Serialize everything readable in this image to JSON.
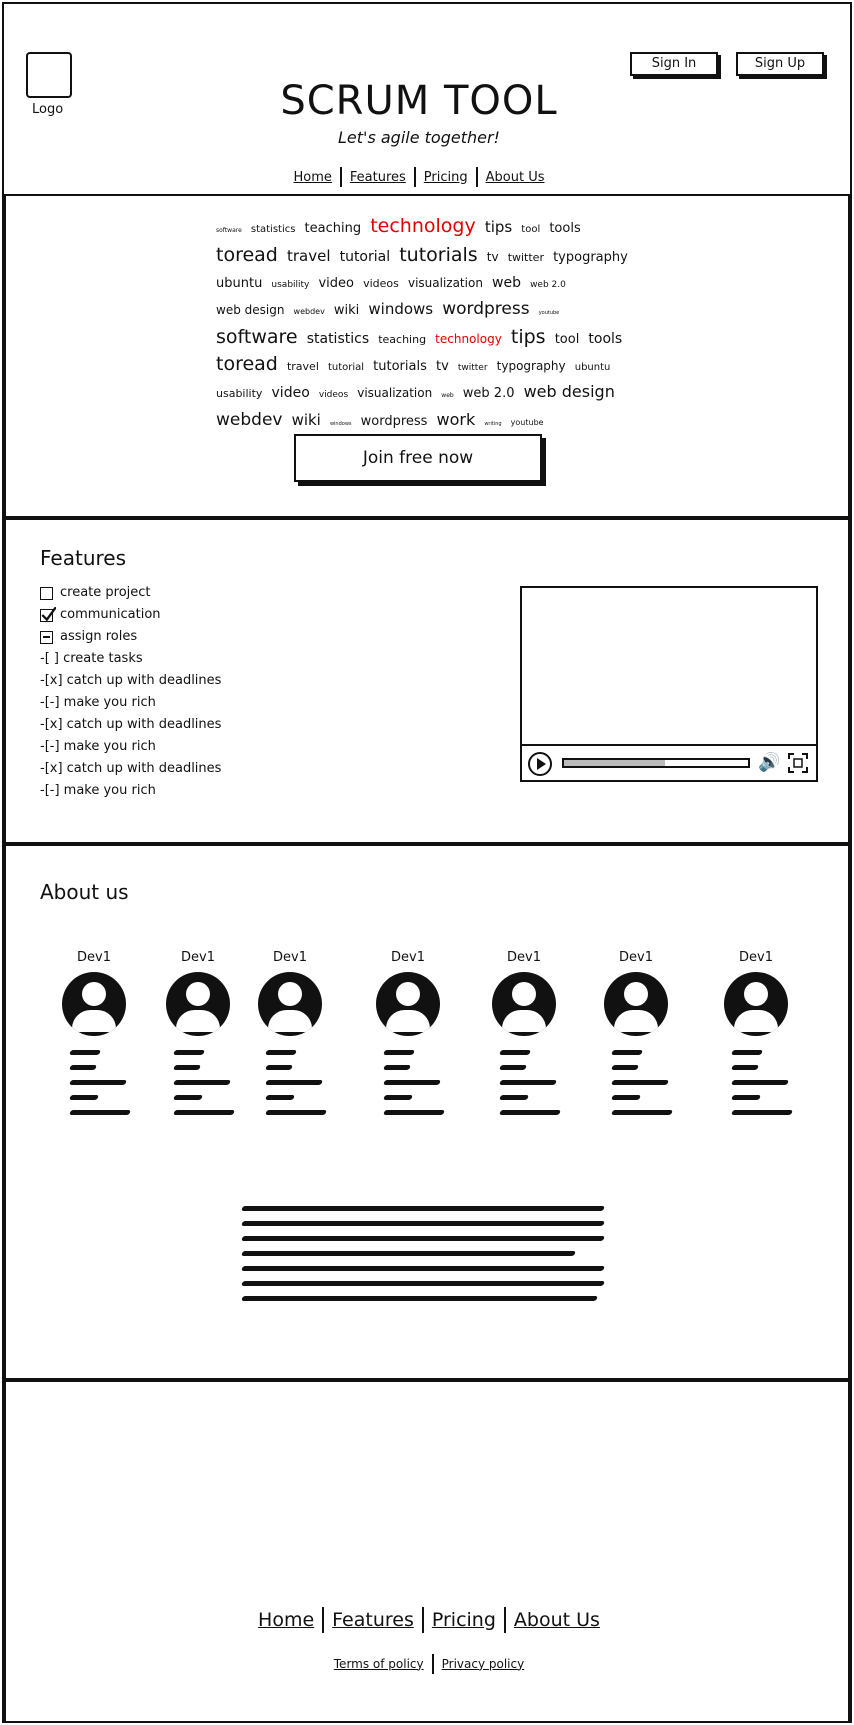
{
  "header": {
    "logo_label": "Logo",
    "title": "SCRUM TOOL",
    "tagline": "Let's agile together!",
    "sign_in": "Sign In",
    "sign_up": "Sign Up",
    "nav": [
      "Home",
      "Features",
      "Pricing",
      "About Us"
    ]
  },
  "hero": {
    "tags": [
      {
        "t": "software",
        "s": 6
      },
      {
        "t": "statistics",
        "s": 10
      },
      {
        "t": "teaching",
        "s": 13
      },
      {
        "t": "technology",
        "s": 19,
        "c": "#e60000"
      },
      {
        "t": "tips",
        "s": 15
      },
      {
        "t": "tool",
        "s": 10
      },
      {
        "t": "tools",
        "s": 13
      },
      {
        "t": "toread",
        "s": 19
      },
      {
        "t": "travel",
        "s": 15
      },
      {
        "t": "tutorial",
        "s": 14
      },
      {
        "t": "tutorials",
        "s": 19
      },
      {
        "t": "tv",
        "s": 12
      },
      {
        "t": "twitter",
        "s": 11
      },
      {
        "t": "typography",
        "s": 13
      },
      {
        "t": "ubuntu",
        "s": 13
      },
      {
        "t": "usability",
        "s": 9
      },
      {
        "t": "video",
        "s": 13
      },
      {
        "t": "videos",
        "s": 11
      },
      {
        "t": "visualization",
        "s": 12
      },
      {
        "t": "web",
        "s": 14
      },
      {
        "t": "web 2.0",
        "s": 9
      },
      {
        "t": "web design",
        "s": 12
      },
      {
        "t": "webdev",
        "s": 8
      },
      {
        "t": "wiki",
        "s": 13
      },
      {
        "t": "windows",
        "s": 15
      },
      {
        "t": "wordpress",
        "s": 17
      },
      {
        "t": "youtube",
        "s": 5
      },
      {
        "t": "software",
        "s": 19
      },
      {
        "t": "statistics",
        "s": 14
      },
      {
        "t": "teaching",
        "s": 11
      },
      {
        "t": "technology",
        "s": 12,
        "c": "#e60000"
      },
      {
        "t": "tips",
        "s": 19
      },
      {
        "t": "tool",
        "s": 13
      },
      {
        "t": "tools",
        "s": 14
      },
      {
        "t": "toread",
        "s": 19
      },
      {
        "t": "travel",
        "s": 11
      },
      {
        "t": "tutorial",
        "s": 10
      },
      {
        "t": "tutorials",
        "s": 13
      },
      {
        "t": "tv",
        "s": 13
      },
      {
        "t": "twitter",
        "s": 9
      },
      {
        "t": "typography",
        "s": 12
      },
      {
        "t": "ubuntu",
        "s": 10
      },
      {
        "t": "usability",
        "s": 11
      },
      {
        "t": "video",
        "s": 14
      },
      {
        "t": "videos",
        "s": 9
      },
      {
        "t": "visualization",
        "s": 12
      },
      {
        "t": "web",
        "s": 6
      },
      {
        "t": "web 2.0",
        "s": 13
      },
      {
        "t": "web design",
        "s": 16
      },
      {
        "t": "webdev",
        "s": 17
      },
      {
        "t": "wiki",
        "s": 15
      },
      {
        "t": "windows",
        "s": 5
      },
      {
        "t": "wordpress",
        "s": 13
      },
      {
        "t": "work",
        "s": 16
      },
      {
        "t": "writing",
        "s": 5
      },
      {
        "t": "youtube",
        "s": 8
      }
    ],
    "cta": "Join free now"
  },
  "features": {
    "title": "Features",
    "items": [
      {
        "label": "create project",
        "state": "unchecked"
      },
      {
        "label": "communication",
        "state": "checked"
      },
      {
        "label": "assign roles",
        "state": "indeterminate"
      },
      {
        "label": "-[ ] create tasks",
        "state": "none"
      },
      {
        "label": "-[x] catch up with deadlines",
        "state": "none"
      },
      {
        "label": "-[-] make you rich",
        "state": "none"
      },
      {
        "label": "-[x] catch up with deadlines",
        "state": "none"
      },
      {
        "label": "-[-] make you rich",
        "state": "none"
      },
      {
        "label": "-[x] catch up with deadlines",
        "state": "none"
      },
      {
        "label": "-[-] make you rich",
        "state": "none"
      }
    ],
    "video_progress": 0.55
  },
  "about": {
    "title": "About us",
    "devs": [
      "Dev1",
      "Dev1",
      "Dev1",
      "Dev1",
      "Dev1",
      "Dev1",
      "Dev1"
    ]
  },
  "footer": {
    "nav": [
      "Home",
      "Features",
      "Pricing",
      "About Us"
    ],
    "links": [
      "Terms of policy",
      "Privacy policy"
    ]
  }
}
